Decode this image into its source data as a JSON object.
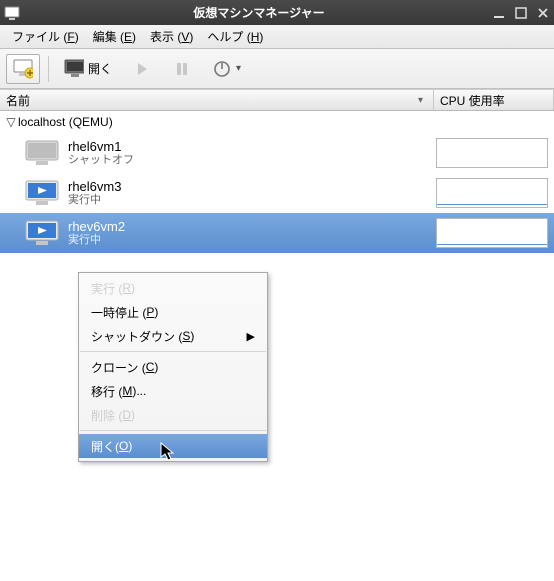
{
  "window": {
    "title": "仮想マシンマネージャー"
  },
  "menubar": {
    "file": "ファイル (F)",
    "edit": "編集 (E)",
    "view": "表示 (V)",
    "help": "ヘルプ (H)"
  },
  "toolbar": {
    "open": "開く"
  },
  "columns": {
    "name": "名前",
    "cpu": "CPU 使用率"
  },
  "host": {
    "label": "localhost (QEMU)"
  },
  "vms": [
    {
      "name": "rhel6vm1",
      "status": "シャットオフ",
      "running": false,
      "selected": false
    },
    {
      "name": "rhel6vm3",
      "status": "実行中",
      "running": true,
      "selected": false
    },
    {
      "name": "rhev6vm2",
      "status": "実行中",
      "running": true,
      "selected": true
    }
  ],
  "context_menu": {
    "run": "実行 (R)",
    "pause": "一時停止 (P)",
    "shutdown": "シャットダウン (S)",
    "clone": "クローン (C)",
    "migrate": "移行 (M)...",
    "delete": "削除 (D)",
    "open": "開く(O)"
  }
}
